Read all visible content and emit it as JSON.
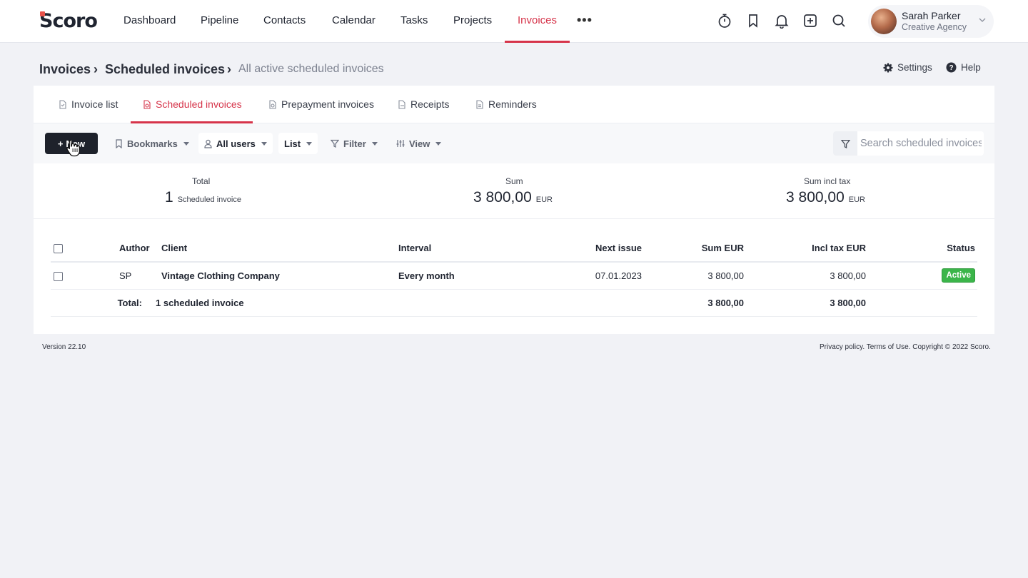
{
  "app": {
    "logo_text": "Scoro",
    "brand_color": "#d6344a"
  },
  "nav": {
    "items": [
      "Dashboard",
      "Pipeline",
      "Contacts",
      "Calendar",
      "Tasks",
      "Projects",
      "Invoices"
    ],
    "active": "Invoices",
    "more": "•••",
    "icons": [
      "timer-icon",
      "bookmark-icon",
      "bell-icon",
      "add-icon",
      "search-icon"
    ]
  },
  "user": {
    "name": "Sarah Parker",
    "company": "Creative Agency"
  },
  "breadcrumb": {
    "level1": "Invoices",
    "level2": "Scheduled invoices",
    "current": "All active scheduled invoices",
    "separator": "›"
  },
  "header_links": {
    "settings": "Settings",
    "help": "Help"
  },
  "tabs": [
    {
      "label": "Invoice list"
    },
    {
      "label": "Scheduled invoices"
    },
    {
      "label": "Prepayment invoices"
    },
    {
      "label": "Receipts"
    },
    {
      "label": "Reminders"
    }
  ],
  "active_tab": "Scheduled invoices",
  "toolbar": {
    "new_label": "New",
    "bookmarks": "Bookmarks",
    "users": "All users",
    "list": "List",
    "filter": "Filter",
    "view": "View",
    "search_placeholder": "Search scheduled invoices"
  },
  "summary": {
    "total_label": "Total",
    "total_value": "1",
    "total_unit": "Scheduled invoice",
    "sum_label": "Sum",
    "sum_value": "3 800,00",
    "sum_unit": "EUR",
    "sum_tax_label": "Sum incl tax",
    "sum_tax_value": "3 800,00",
    "sum_tax_unit": "EUR"
  },
  "table": {
    "headers": {
      "author": "Author",
      "client": "Client",
      "interval": "Interval",
      "next_issue": "Next issue",
      "sum": "Sum EUR",
      "incl_tax": "Incl tax EUR",
      "status": "Status"
    },
    "rows": [
      {
        "author": "SP",
        "client": "Vintage Clothing Company",
        "interval": "Every month",
        "next_issue": "07.01.2023",
        "sum": "3 800,00",
        "incl_tax": "3 800,00",
        "status": "Active"
      }
    ],
    "total_row": {
      "label": "Total:",
      "count": "1 scheduled invoice",
      "sum": "3 800,00",
      "incl_tax": "3 800,00"
    }
  },
  "footer": {
    "version": "Version 22.10",
    "legal": "Privacy policy. Terms of Use. Copyright © 2022 Scoro."
  }
}
